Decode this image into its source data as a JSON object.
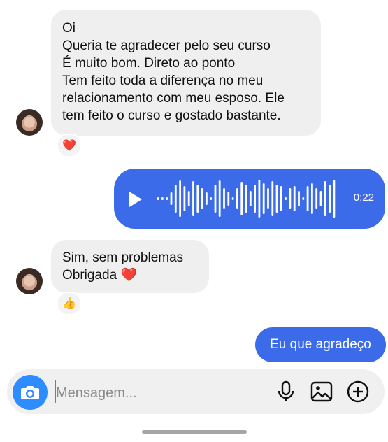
{
  "messages": {
    "first": {
      "lines": [
        "Oi",
        "Queria te agradecer pelo seu curso",
        "É muito bom. Direto ao ponto",
        "Tem feito toda a diferença no meu",
        "relacionamento com meu esposo. Ele",
        "tem feito o curso e gostado bastante."
      ],
      "reaction": "❤️"
    },
    "voice": {
      "duration": "0:22"
    },
    "second": {
      "lines": [
        "Sim, sem problemas",
        "Obrigada ❤️"
      ],
      "reaction": "👍"
    },
    "outgoing": {
      "text": "Eu que agradeço"
    }
  },
  "composer": {
    "placeholder": "Mensagem...",
    "icons": [
      "camera-icon",
      "microphone-icon",
      "gallery-icon",
      "plus-icon"
    ]
  },
  "colors": {
    "accent": "#3b6be8",
    "camera": "#2d8cff",
    "incoming_bubble": "#efefef"
  }
}
